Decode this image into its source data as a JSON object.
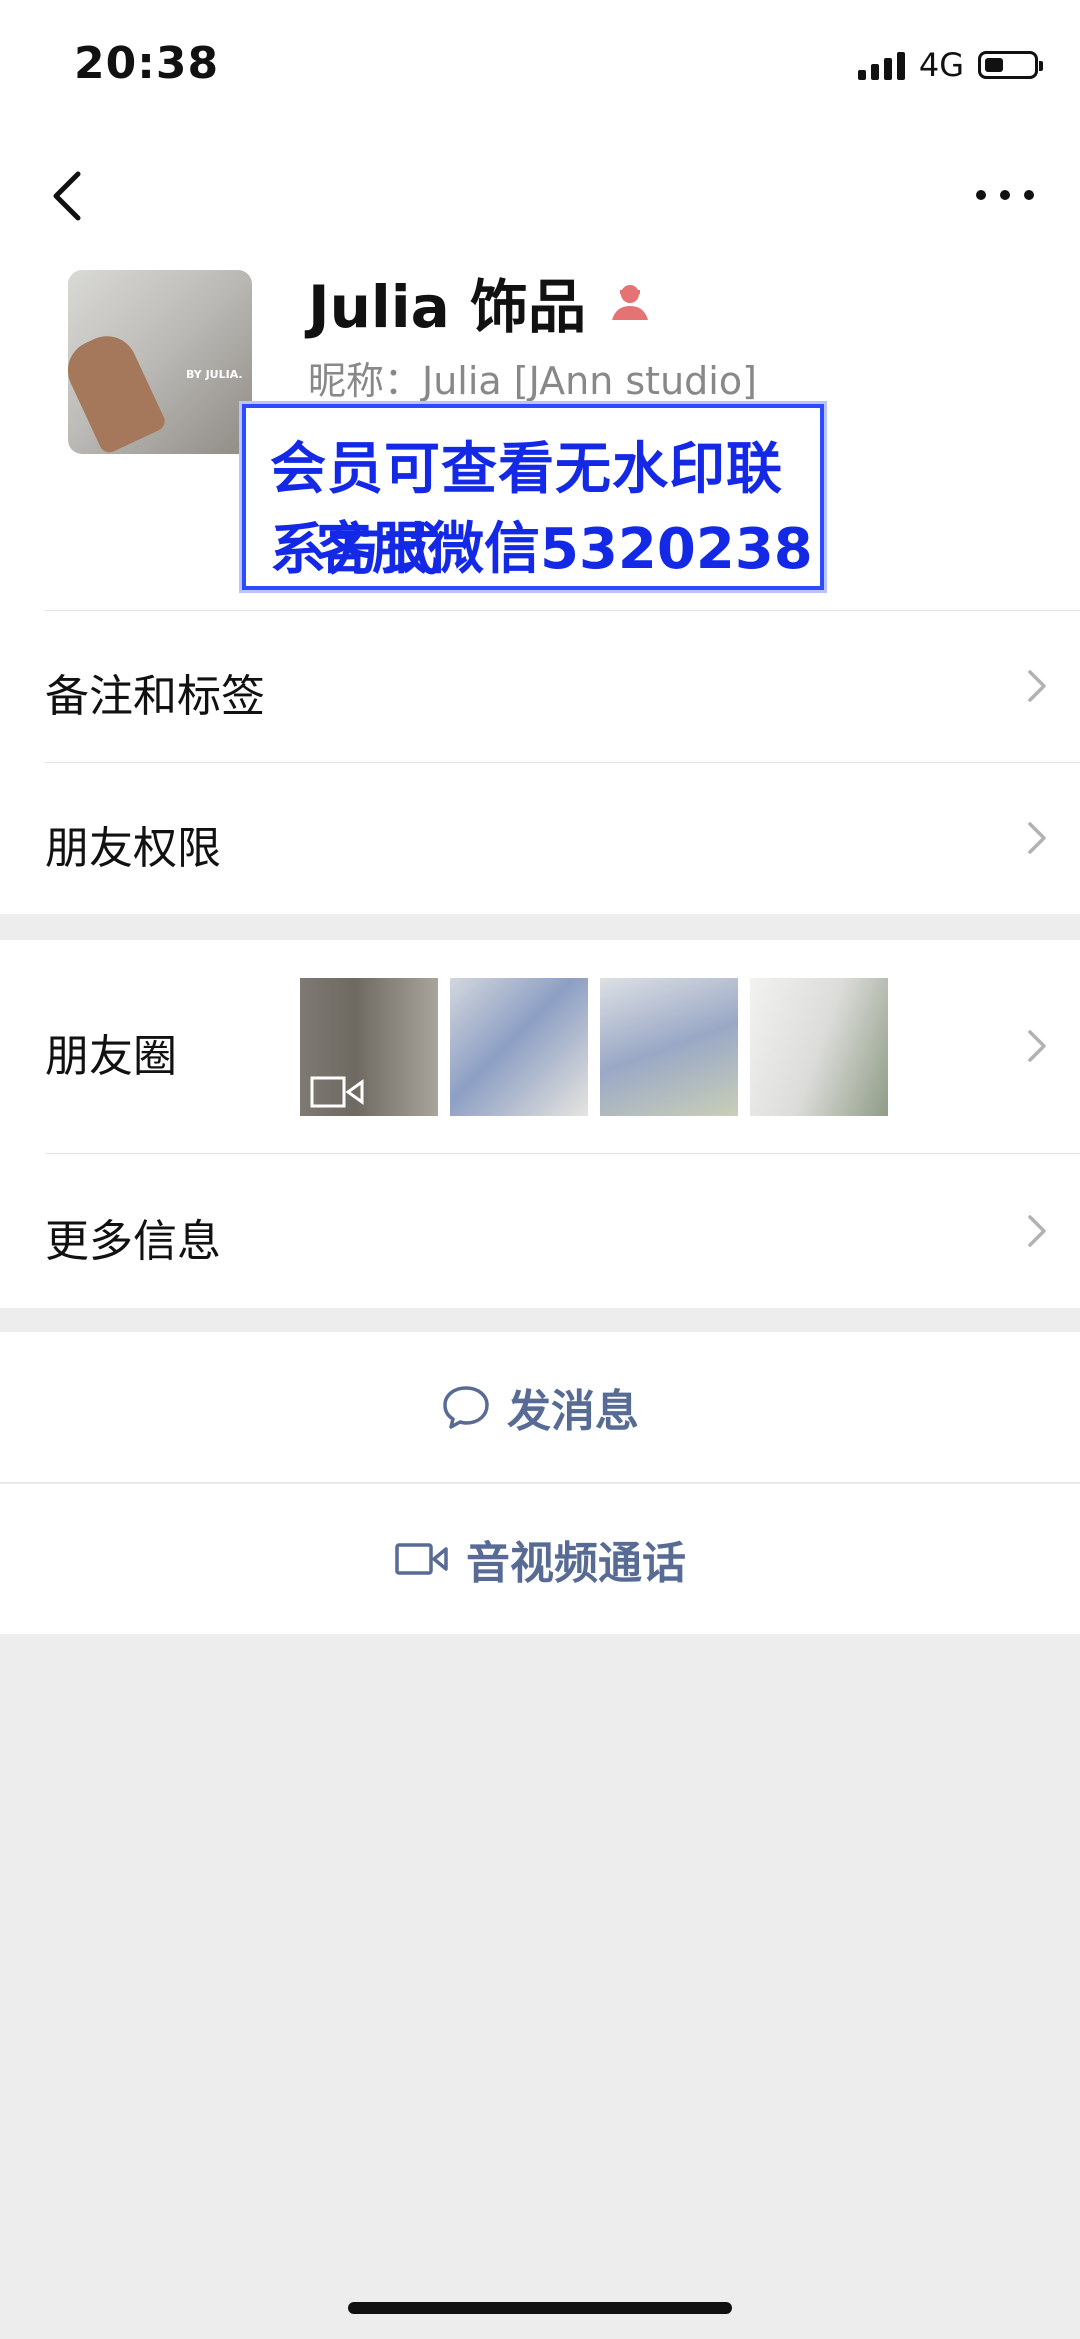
{
  "status_bar": {
    "time": "20:38",
    "network": "4G"
  },
  "profile": {
    "name": "Julia 饰品",
    "nickname": "昵称：Julia [JAnn studio]",
    "avatar_text": "BY JULIA."
  },
  "watermark": {
    "line1": "会员可查看无水印联系方式",
    "line2": "客服微信5320238"
  },
  "rows": {
    "remark": "备注和标签",
    "permissions": "朋友权限",
    "moments": "朋友圈",
    "more_info": "更多信息"
  },
  "actions": {
    "message": "发消息",
    "call": "音视频通话"
  },
  "colors": {
    "link": "#576b95",
    "watermark": "#1329e6",
    "background": "#ededed"
  }
}
